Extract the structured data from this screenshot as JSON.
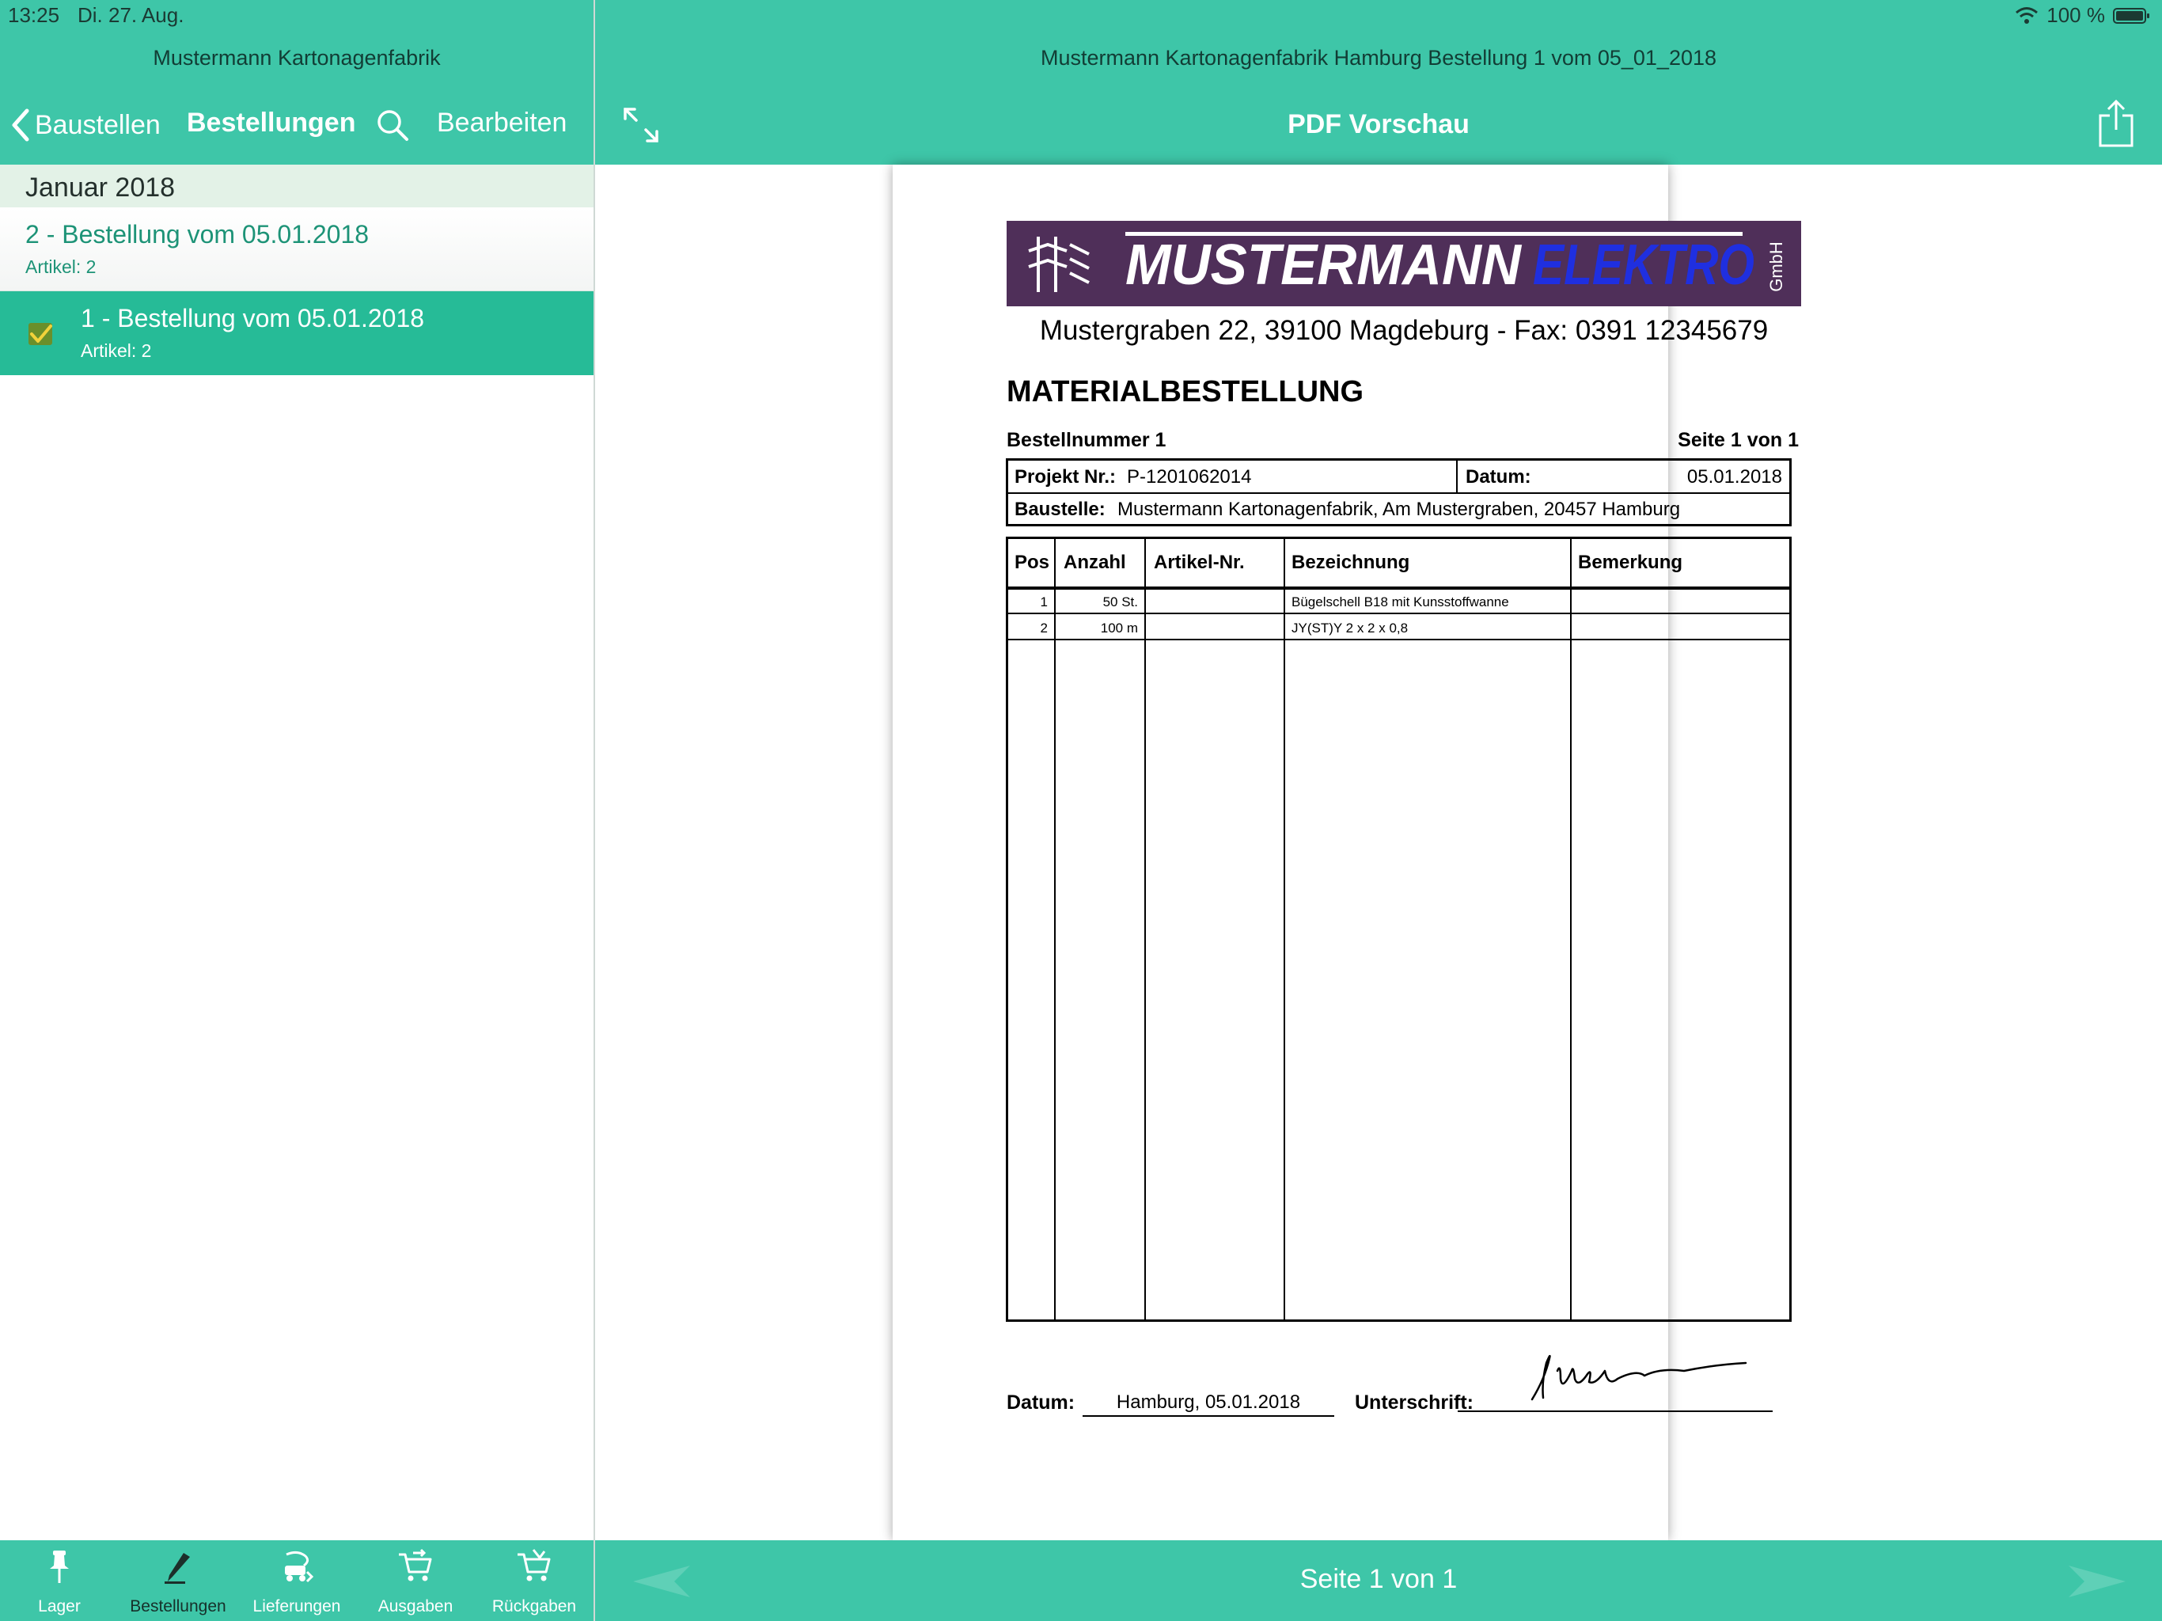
{
  "status_bar": {
    "time": "13:25",
    "date": "Di. 27. Aug.",
    "battery": "100 %"
  },
  "master": {
    "window_title": "Mustermann Kartonagenfabrik",
    "back_label": "Baustellen",
    "nav_title": "Bestellungen",
    "edit_label": "Bearbeiten",
    "section_label": "Januar 2018",
    "rows": [
      {
        "title": "2 - Bestellung vom 05.01.2018",
        "subtitle": "Artikel: 2",
        "selected": false
      },
      {
        "title": "1 - Bestellung vom 05.01.2018",
        "subtitle": "Artikel: 2",
        "selected": true,
        "icon": "order-sent-icon"
      }
    ]
  },
  "detail": {
    "window_title": "Mustermann Kartonagenfabrik Hamburg Bestellung 1 vom 05_01_2018",
    "nav_title": "PDF Vorschau",
    "page_indicator": "Seite 1 von 1"
  },
  "document": {
    "logo_text": "MUSTERMANN ELEKTRO GmbH",
    "address": "Mustergraben 22, 39100 Magdeburg  -  Fax: 0391 12345679",
    "heading": "MATERIALBESTELLUNG",
    "bestellnummer": "Bestellnummer 1",
    "seite": "Seite 1 von 1",
    "projekt_label": "Projekt Nr.:",
    "projekt_value": "P-1201062014",
    "datum_label": "Datum:",
    "datum_value": "05.01.2018",
    "baustelle_label": "Baustelle:",
    "baustelle_value": "Mustermann Kartonagenfabrik, Am Mustergraben, 20457 Hamburg",
    "columns": [
      "Pos",
      "Anzahl",
      "Artikel-Nr.",
      "Bezeichnung",
      "Bemerkung"
    ],
    "items": [
      {
        "pos": "1",
        "anzahl": "50 St.",
        "artikel": "",
        "bezeichnung": "Bügelschell B18 mit Kunsstoffwanne",
        "bemerkung": ""
      },
      {
        "pos": "2",
        "anzahl": "100 m",
        "artikel": "",
        "bezeichnung": "JY(ST)Y 2 x 2 x 0,8",
        "bemerkung": ""
      }
    ],
    "footer_datum_label": "Datum:",
    "footer_datum_value": "Hamburg, 05.01.2018",
    "signature_label": "Unterschrift:"
  },
  "tabs": [
    {
      "label": "Lager",
      "icon": "pin-icon"
    },
    {
      "label": "Bestellungen",
      "icon": "pencil-icon",
      "active": true
    },
    {
      "label": "Lieferungen",
      "icon": "delivery-icon"
    },
    {
      "label": "Ausgaben",
      "icon": "cart-out-icon"
    },
    {
      "label": "Rückgaben",
      "icon": "cart-return-icon"
    }
  ],
  "colors": {
    "accent": "#3ec6a8",
    "selected_row": "#26bb97",
    "section_bg": "#e3f2e7",
    "logo_bg": "#4f2f59",
    "logo_blue": "#1f2fe0"
  }
}
